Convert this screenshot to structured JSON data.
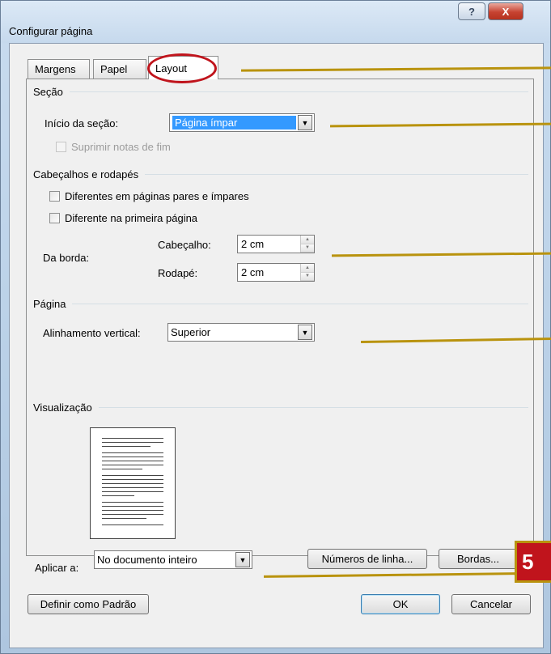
{
  "window": {
    "title": "Configurar página",
    "help_glyph": "?",
    "close_glyph": "X"
  },
  "tabs": [
    {
      "label": "Margens"
    },
    {
      "label": "Papel"
    },
    {
      "label": "Layout"
    }
  ],
  "secao": {
    "header": "Seção",
    "inicio_label": "Início da seção:",
    "inicio_value": "Página ímpar",
    "suprimir_label": "Suprimir notas de fim"
  },
  "cabecalhos": {
    "header": "Cabeçalhos e rodapés",
    "diferentes_pares": "Diferentes em páginas pares e ímpares",
    "diferente_primeira": "Diferente na primeira página",
    "da_borda_label": "Da borda:",
    "cabecalho_label": "Cabeçalho:",
    "cabecalho_value": "2 cm",
    "rodape_label": "Rodapé:",
    "rodape_value": "2 cm"
  },
  "pagina": {
    "header": "Página",
    "alinhamento_label": "Alinhamento vertical:",
    "alinhamento_value": "Superior"
  },
  "visualizacao": {
    "header": "Visualização",
    "aplicar_label": "Aplicar a:",
    "aplicar_value": "No documento inteiro",
    "numeros_button": "Números de linha...",
    "bordas_button": "Bordas..."
  },
  "footer": {
    "definir_button": "Definir como Padrão",
    "ok_button": "OK",
    "cancelar_button": "Cancelar"
  },
  "annotation": {
    "badge_text": "5"
  },
  "colors": {
    "annotation_line": "#b9930e",
    "highlight_red": "#c0141c",
    "selection_blue": "#3399ff"
  }
}
